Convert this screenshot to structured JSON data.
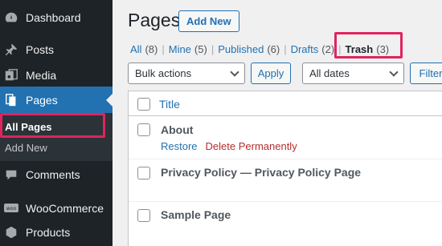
{
  "colors": {
    "sidebar_bg": "#1d2327",
    "accent": "#2271b1",
    "highlight": "#e0245e",
    "delete": "#b32d2e"
  },
  "sidebar": {
    "items": [
      {
        "label": "Dashboard",
        "icon": "dashboard-icon"
      },
      {
        "label": "Posts",
        "icon": "pin-icon"
      },
      {
        "label": "Media",
        "icon": "media-icon"
      },
      {
        "label": "Pages",
        "icon": "pages-icon",
        "active": true
      },
      {
        "label": "Comments",
        "icon": "comment-icon"
      },
      {
        "label": "WooCommerce",
        "icon": "woocommerce-icon"
      },
      {
        "label": "Products",
        "icon": "products-icon"
      }
    ],
    "submenu": [
      {
        "label": "All Pages",
        "current": true
      },
      {
        "label": "Add New"
      }
    ]
  },
  "header": {
    "title": "Pages",
    "add_new": "Add New"
  },
  "filters": [
    {
      "label": "All",
      "count": "(8)"
    },
    {
      "label": "Mine",
      "count": "(5)"
    },
    {
      "label": "Published",
      "count": "(6)"
    },
    {
      "label": "Drafts",
      "count": "(2)"
    },
    {
      "label": "Trash",
      "count": "(3)",
      "current": true
    }
  ],
  "toolbar": {
    "bulk_actions": "Bulk actions",
    "apply": "Apply",
    "dates": "All dates",
    "filter": "Filter"
  },
  "table": {
    "column_title": "Title",
    "rows": [
      {
        "title": "About",
        "actions": [
          "Restore",
          "Delete Permanently"
        ]
      },
      {
        "title": "Privacy Policy — Privacy Policy Page"
      },
      {
        "title": "Sample Page"
      }
    ]
  }
}
